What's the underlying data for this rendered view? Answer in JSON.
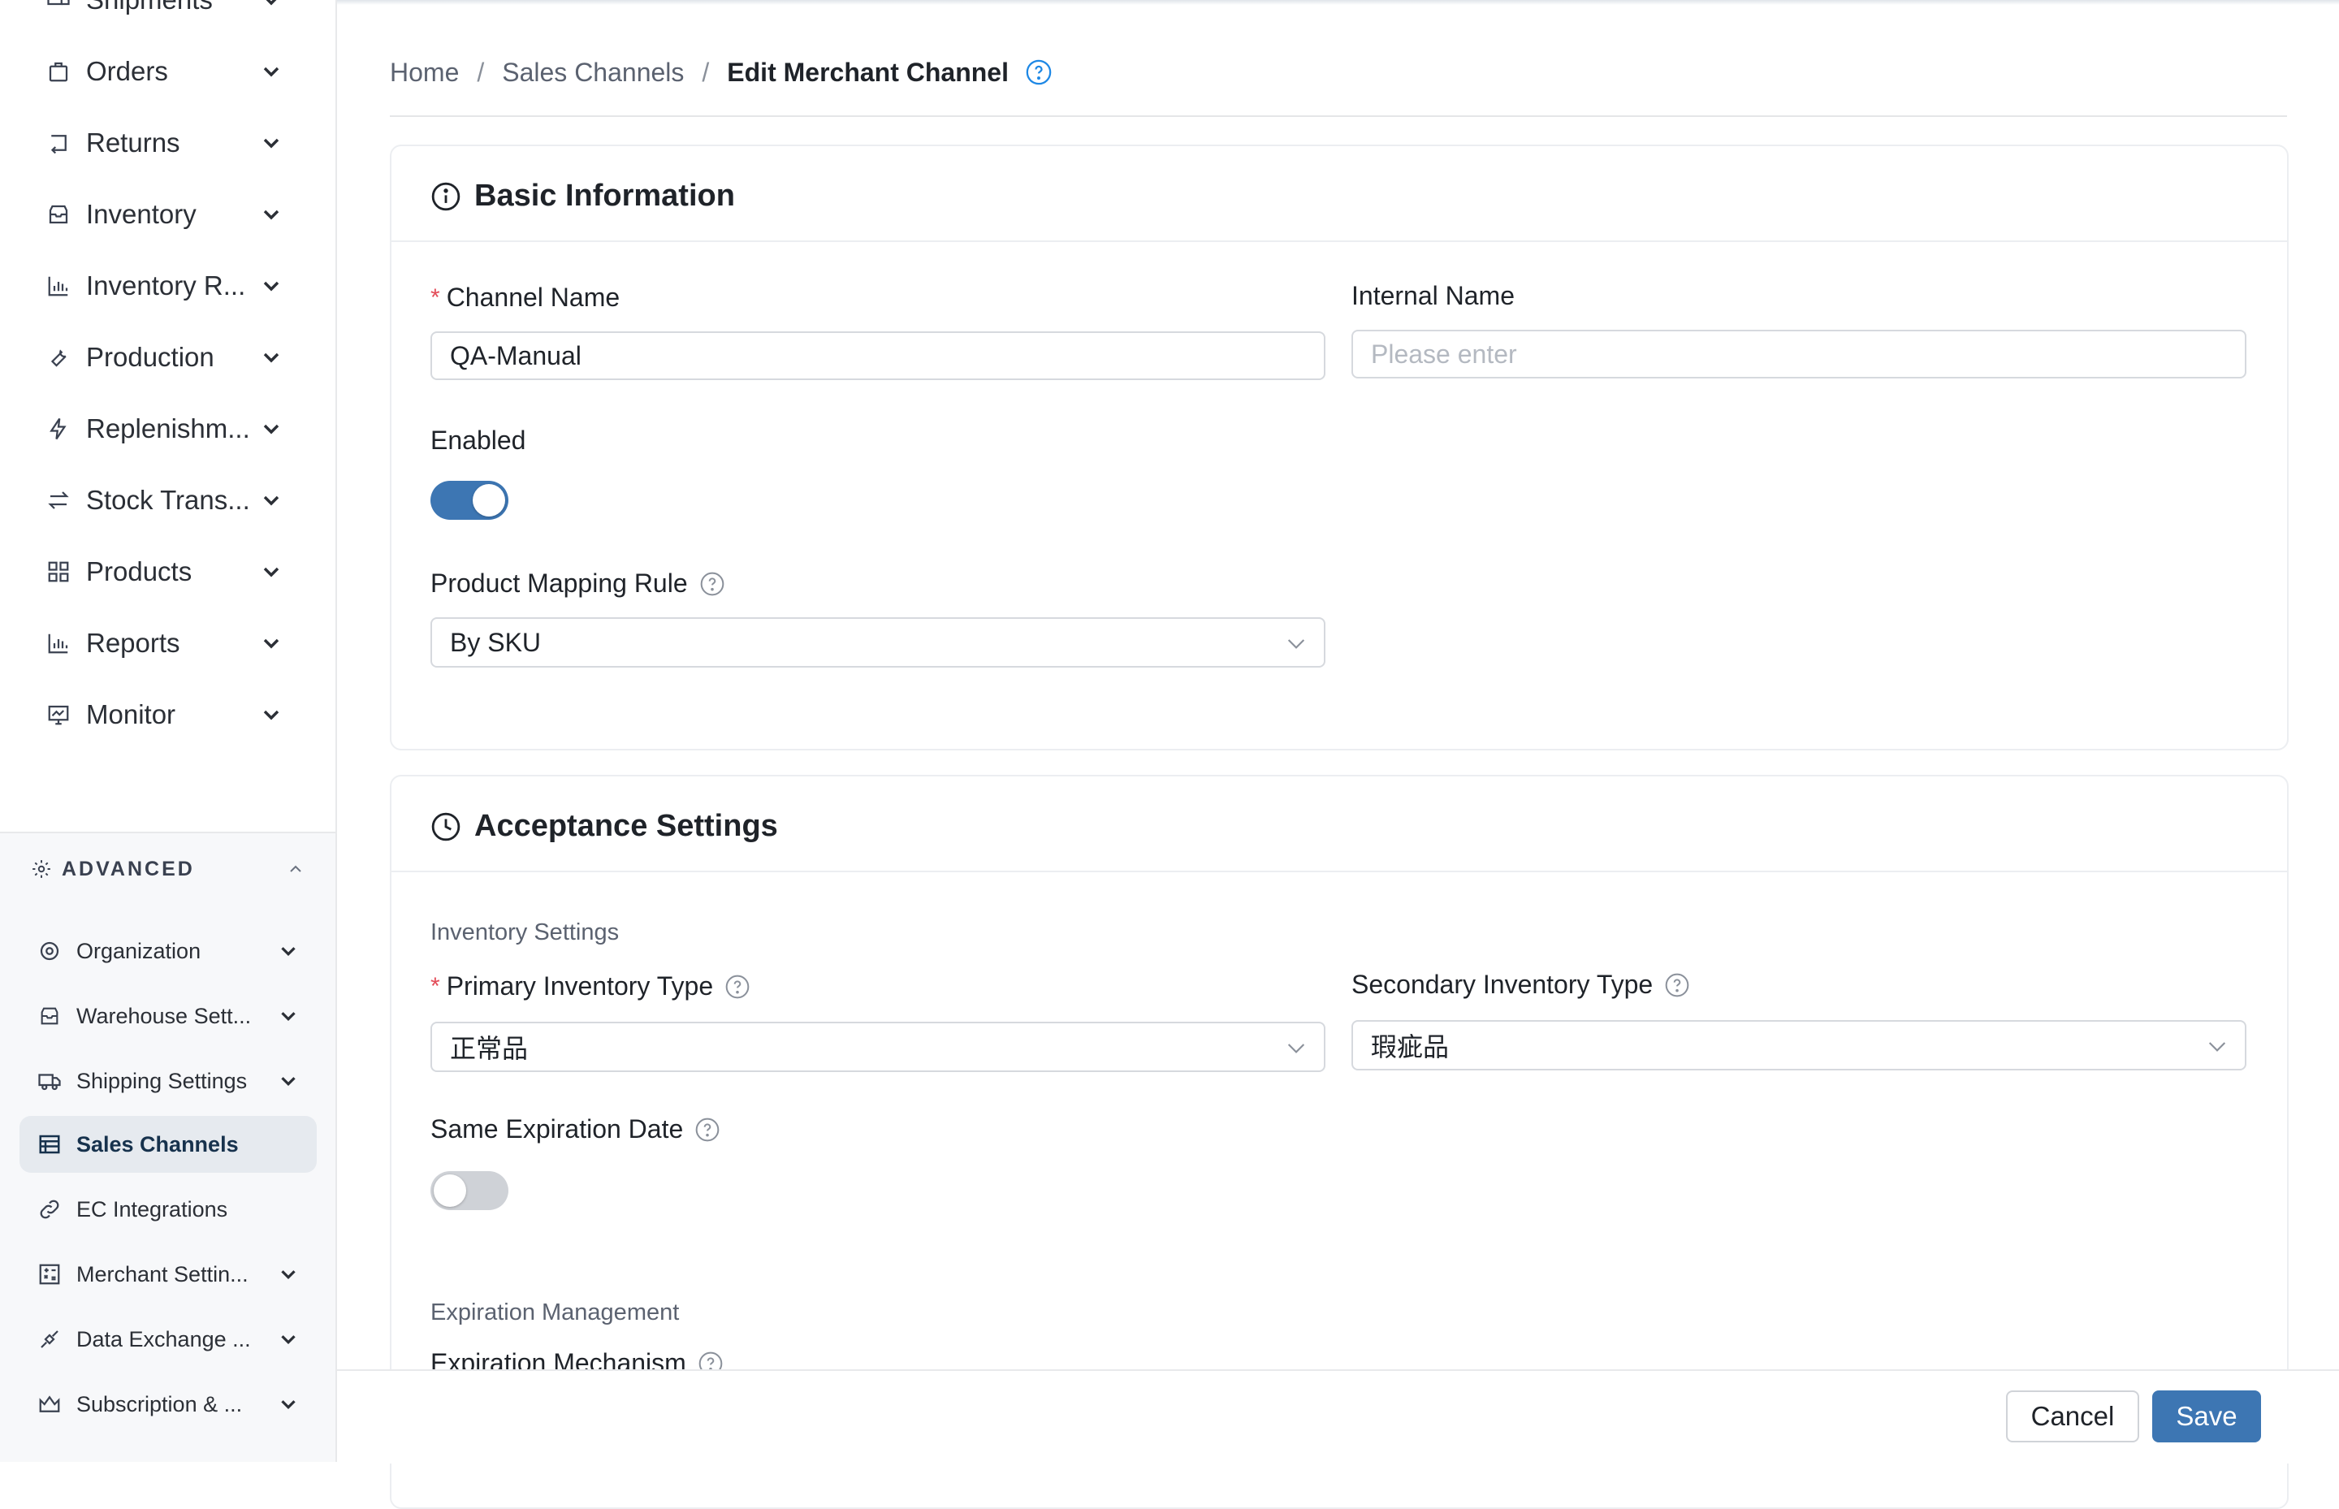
{
  "sidebar": {
    "items": [
      {
        "label": "Shipments",
        "icon": "truck-icon"
      },
      {
        "label": "Orders",
        "icon": "bag-icon"
      },
      {
        "label": "Returns",
        "icon": "return-icon"
      },
      {
        "label": "Inventory",
        "icon": "box-icon"
      },
      {
        "label": "Inventory R...",
        "icon": "bar-chart-icon"
      },
      {
        "label": "Production",
        "icon": "wrench-icon"
      },
      {
        "label": "Replenishm...",
        "icon": "bolt-icon"
      },
      {
        "label": "Stock Trans...",
        "icon": "transfer-icon"
      },
      {
        "label": "Products",
        "icon": "grid-icon"
      },
      {
        "label": "Reports",
        "icon": "bar-chart-icon"
      },
      {
        "label": "Monitor",
        "icon": "monitor-icon"
      }
    ],
    "advanced": {
      "title": "ADVANCED",
      "items": [
        {
          "label": "Organization",
          "icon": "gear-icon"
        },
        {
          "label": "Warehouse Sett...",
          "icon": "box-icon"
        },
        {
          "label": "Shipping Settings",
          "icon": "truck-icon"
        },
        {
          "label": "Sales Channels",
          "icon": "store-icon",
          "active": true
        },
        {
          "label": "EC Integrations",
          "icon": "link-icon"
        },
        {
          "label": "Merchant Settin...",
          "icon": "calculator-icon"
        },
        {
          "label": "Data Exchange ...",
          "icon": "plug-icon"
        },
        {
          "label": "Subscription & ...",
          "icon": "crown-icon"
        }
      ]
    }
  },
  "breadcrumb": {
    "home": "Home",
    "parent": "Sales Channels",
    "current": "Edit Merchant Channel",
    "separator": "/"
  },
  "basic": {
    "title": "Basic Information",
    "channel_name_label": "Channel Name",
    "channel_name_value": "QA-Manual",
    "internal_name_label": "Internal Name",
    "internal_name_placeholder": "Please enter",
    "enabled_label": "Enabled",
    "enabled": true,
    "mapping_label": "Product Mapping Rule",
    "mapping_value": "By SKU"
  },
  "acceptance": {
    "title": "Acceptance Settings",
    "inventory_section": "Inventory Settings",
    "primary_label": "Primary Inventory Type",
    "primary_value": "正常品",
    "secondary_label": "Secondary Inventory Type",
    "secondary_value": "瑕疵品",
    "same_exp_label": "Same Expiration Date",
    "same_exp_enabled": false,
    "expiration_section": "Expiration Management",
    "mechanism_label": "Expiration Mechanism"
  },
  "footer": {
    "cancel": "Cancel",
    "save": "Save"
  },
  "colors": {
    "primary": "#3d76b3",
    "required": "#e34d59",
    "help": "#1e88e5"
  }
}
